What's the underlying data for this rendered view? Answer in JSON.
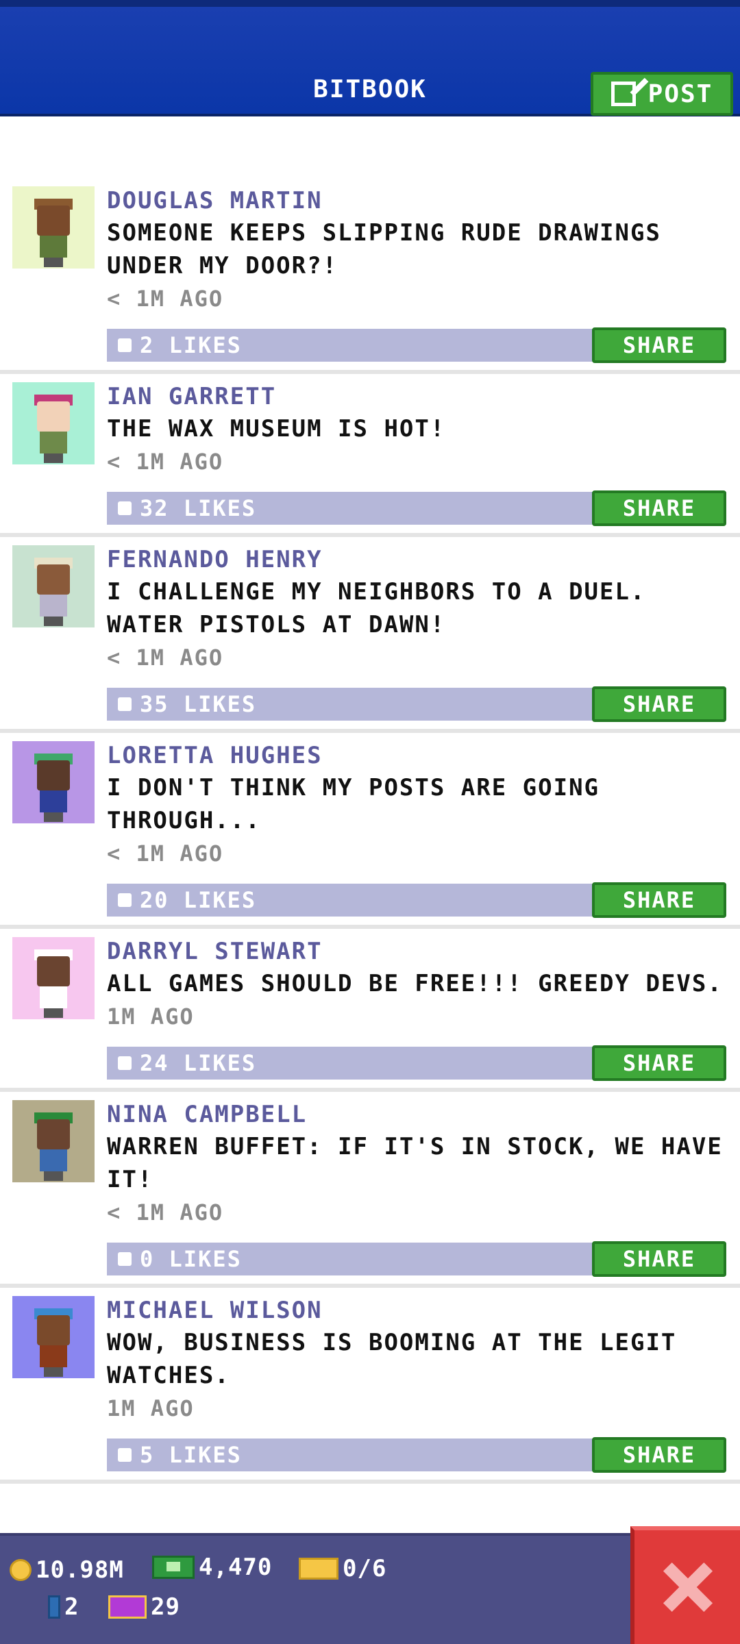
{
  "header": {
    "title": "BITBOOK",
    "post_label": "POST"
  },
  "posts": [
    {
      "name": "DOUGLAS MARTIN",
      "message": "SOMEONE KEEPS SLIPPING RUDE DRAWINGS UNDER MY DOOR?!",
      "time": "< 1M AGO",
      "likes": "2 LIKES",
      "share": "SHARE",
      "avatar": {
        "bg": "#ecf6c9",
        "skin": "#7a4a2b",
        "hair": "#8a5a30",
        "shirt": "#5e7a3a"
      }
    },
    {
      "name": "IAN GARRETT",
      "message": "THE WAX MUSEUM IS HOT!",
      "time": "< 1M AGO",
      "likes": "32 LIKES",
      "share": "SHARE",
      "avatar": {
        "bg": "#a9f0d6",
        "skin": "#f2d2b8",
        "hair": "#c23b7a",
        "shirt": "#6e8a4a"
      }
    },
    {
      "name": "FERNANDO HENRY",
      "message": "I CHALLENGE MY NEIGHBORS TO A DUEL. WATER PISTOLS AT DAWN!",
      "time": "< 1M AGO",
      "likes": "35 LIKES",
      "share": "SHARE",
      "avatar": {
        "bg": "#c8e2d0",
        "skin": "#8a5a3a",
        "hair": "#e8e2c8",
        "shirt": "#b9b4cc"
      }
    },
    {
      "name": "LORETTA HUGHES",
      "message": "I DON'T THINK MY POSTS ARE GOING THROUGH...",
      "time": "< 1M AGO",
      "likes": "20 LIKES",
      "share": "SHARE",
      "avatar": {
        "bg": "#b896e6",
        "skin": "#5a3a2a",
        "hair": "#3fa86a",
        "shirt": "#2d3f9a"
      }
    },
    {
      "name": "DARRYL STEWART",
      "message": "ALL GAMES SHOULD BE FREE!!! GREEDY DEVS.",
      "time": "1M AGO",
      "likes": "24 LIKES",
      "share": "SHARE",
      "avatar": {
        "bg": "#f7c7ef",
        "skin": "#6a4430",
        "hair": "#ffffff",
        "shirt": "#ffffff"
      }
    },
    {
      "name": "NINA CAMPBELL",
      "message": "WARREN BUFFET: IF IT'S IN STOCK, WE HAVE IT!",
      "time": "< 1M AGO",
      "likes": "0 LIKES",
      "share": "SHARE",
      "avatar": {
        "bg": "#b3ab8a",
        "skin": "#6a4430",
        "hair": "#2a8a3a",
        "shirt": "#3a6ab0"
      }
    },
    {
      "name": "MICHAEL WILSON",
      "message": "WOW, BUSINESS IS BOOMING AT THE LEGIT WATCHES.",
      "time": "1M AGO",
      "likes": "5 LIKES",
      "share": "SHARE",
      "avatar": {
        "bg": "#8a86f0",
        "skin": "#7a4a2b",
        "hair": "#3a8ad0",
        "shirt": "#8a3a1a"
      }
    }
  ],
  "status": {
    "coins": "10.98M",
    "bux": "4,470",
    "tickets": "0/6",
    "bitizens": "2",
    "vip": "29"
  },
  "colors": {
    "header_bg": "#0b36a8",
    "name": "#5b5a9c",
    "likes_bar": "#b5b7d9",
    "share_green": "#3fa83a",
    "bottom_bar": "#4c4e86",
    "close_red": "#e03a3a"
  }
}
